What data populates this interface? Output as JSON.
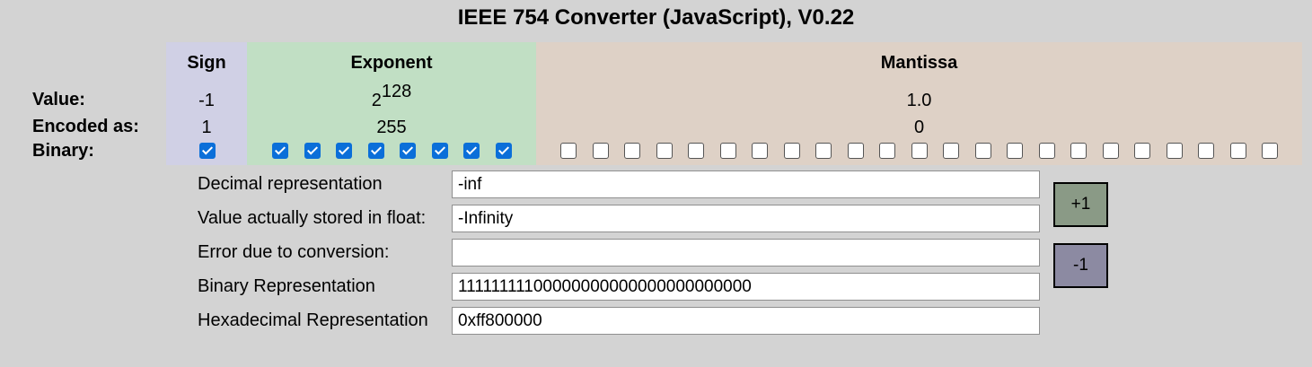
{
  "title": "IEEE 754 Converter (JavaScript), V0.22",
  "row_labels": {
    "value": "Value:",
    "encoded": "Encoded as:",
    "binary": "Binary:"
  },
  "sign": {
    "header": "Sign",
    "value": "-1",
    "encoded": "1",
    "bits": [
      true
    ]
  },
  "exponent": {
    "header": "Exponent",
    "value_base": "2",
    "value_power": "128",
    "encoded": "255",
    "bits": [
      true,
      true,
      true,
      true,
      true,
      true,
      true,
      true
    ]
  },
  "mantissa": {
    "header": "Mantissa",
    "value": "1.0",
    "encoded": "0",
    "bits": [
      false,
      false,
      false,
      false,
      false,
      false,
      false,
      false,
      false,
      false,
      false,
      false,
      false,
      false,
      false,
      false,
      false,
      false,
      false,
      false,
      false,
      false,
      false
    ]
  },
  "fields": {
    "decimal": {
      "label": "Decimal representation",
      "value": "-inf"
    },
    "stored": {
      "label": "Value actually stored in float:",
      "value": "-Infinity"
    },
    "error": {
      "label": "Error due to conversion:",
      "value": ""
    },
    "binary": {
      "label": "Binary Representation",
      "value": "11111111100000000000000000000000"
    },
    "hex": {
      "label": "Hexadecimal Representation",
      "value": "0xff800000"
    }
  },
  "buttons": {
    "plus": "+1",
    "minus": "-1"
  },
  "colors": {
    "background": "#d3d3d3",
    "sign_column": "#d0d0e5",
    "exponent_column": "#c1dfc4",
    "mantissa_column": "#ded1c6",
    "checkbox_checked": "#0b6fd9",
    "plus_button": "#8a9a86",
    "minus_button": "#8c8aa2"
  }
}
